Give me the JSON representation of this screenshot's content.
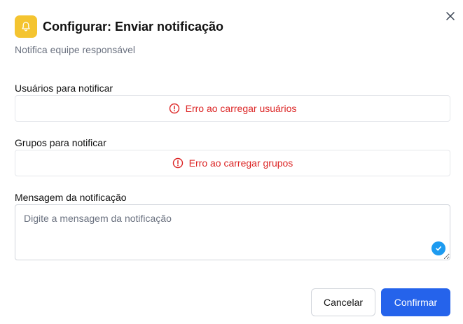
{
  "dialog": {
    "title": "Configurar: Enviar notificação",
    "subtitle": "Notifica equipe responsável",
    "header_icon": "bell-icon",
    "accent_color": "#f4c430",
    "close_icon": "close-icon"
  },
  "fields": {
    "users": {
      "label": "Usuários para notificar",
      "error": "Erro ao carregar usuários"
    },
    "groups": {
      "label": "Grupos para notificar",
      "error": "Erro ao carregar grupos"
    },
    "message": {
      "label": "Mensagem da notificação",
      "placeholder": "Digite a mensagem da notificação",
      "value": ""
    }
  },
  "actions": {
    "cancel_label": "Cancelar",
    "confirm_label": "Confirmar",
    "confirm_color": "#2563eb"
  },
  "colors": {
    "error": "#dc2626"
  }
}
